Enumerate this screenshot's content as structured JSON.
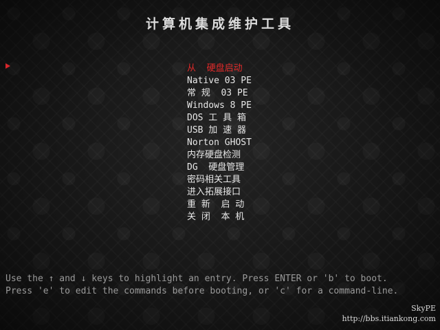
{
  "title": "计算机集成维护工具",
  "menu": {
    "selected_index": 0,
    "items": [
      {
        "label": "从  硬盘启动"
      },
      {
        "label": "Native 03 PE"
      },
      {
        "label": "常 规  03 PE"
      },
      {
        "label": "Windows 8 PE"
      },
      {
        "label": "DOS 工 具 箱"
      },
      {
        "label": "USB 加 速 器"
      },
      {
        "label": "Norton GHOST"
      },
      {
        "label": "内存硬盘检测"
      },
      {
        "label": "DG  硬盘管理"
      },
      {
        "label": "密码相关工具"
      },
      {
        "label": "进入拓展接口"
      },
      {
        "label": "重 新  启 动"
      },
      {
        "label": "关 闭  本 机"
      }
    ]
  },
  "help": {
    "line1": "Use the ↑ and ↓ keys to highlight an entry. Press ENTER or 'b' to boot.",
    "line2": "Press 'e' to edit the commands before booting, or 'c' for a command-line."
  },
  "brand": {
    "name": "SkyPE",
    "url": "http://bbs.itiankong.com"
  },
  "colors": {
    "selected": "#e02a2a",
    "normal": "#e8e8e8",
    "help": "#9a9a9a"
  }
}
